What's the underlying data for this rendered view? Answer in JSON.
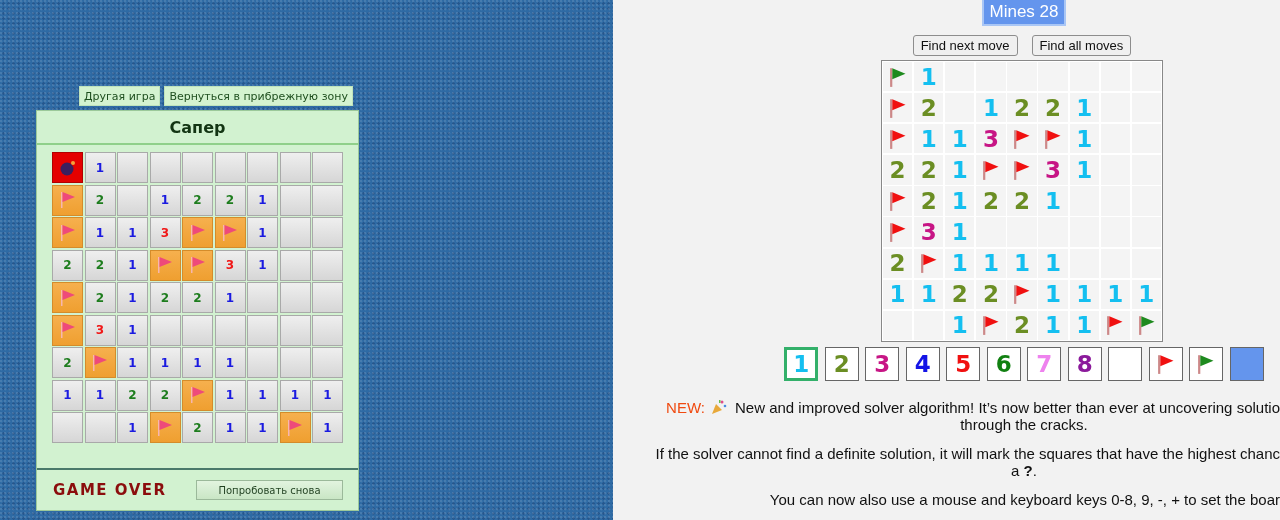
{
  "game": {
    "nav_buttons": [
      "Другая игра",
      "Вернуться в прибрежную зону"
    ],
    "title": "Сапер",
    "rows": [
      [
        {
          "kind": "mine"
        },
        {
          "kind": "number",
          "text": "1",
          "color": "#1a1ae0"
        },
        {
          "kind": "blank"
        },
        {
          "kind": "blank"
        },
        {
          "kind": "blank"
        },
        {
          "kind": "blank"
        },
        {
          "kind": "blank"
        },
        {
          "kind": "blank"
        },
        {
          "kind": "blank"
        }
      ],
      [
        {
          "kind": "flag"
        },
        {
          "kind": "number",
          "text": "2",
          "color": "#1e7d1e"
        },
        {
          "kind": "blank"
        },
        {
          "kind": "number",
          "text": "1",
          "color": "#1a1ae0"
        },
        {
          "kind": "number",
          "text": "2",
          "color": "#1e7d1e"
        },
        {
          "kind": "number",
          "text": "2",
          "color": "#1e7d1e"
        },
        {
          "kind": "number",
          "text": "1",
          "color": "#1a1ae0"
        },
        {
          "kind": "blank"
        },
        {
          "kind": "blank"
        }
      ],
      [
        {
          "kind": "flag"
        },
        {
          "kind": "number",
          "text": "1",
          "color": "#1a1ae0"
        },
        {
          "kind": "number",
          "text": "1",
          "color": "#1a1ae0"
        },
        {
          "kind": "number",
          "text": "3",
          "color": "#f01818"
        },
        {
          "kind": "flag"
        },
        {
          "kind": "flag"
        },
        {
          "kind": "number",
          "text": "1",
          "color": "#1a1ae0"
        },
        {
          "kind": "blank"
        },
        {
          "kind": "blank"
        }
      ],
      [
        {
          "kind": "number",
          "text": "2",
          "color": "#1e7d1e"
        },
        {
          "kind": "number",
          "text": "2",
          "color": "#1e7d1e"
        },
        {
          "kind": "number",
          "text": "1",
          "color": "#1a1ae0"
        },
        {
          "kind": "flag"
        },
        {
          "kind": "flag"
        },
        {
          "kind": "number",
          "text": "3",
          "color": "#f01818"
        },
        {
          "kind": "number",
          "text": "1",
          "color": "#1a1ae0"
        },
        {
          "kind": "blank"
        },
        {
          "kind": "blank"
        }
      ],
      [
        {
          "kind": "flag"
        },
        {
          "kind": "number",
          "text": "2",
          "color": "#1e7d1e"
        },
        {
          "kind": "number",
          "text": "1",
          "color": "#1a1ae0"
        },
        {
          "kind": "number",
          "text": "2",
          "color": "#1e7d1e"
        },
        {
          "kind": "number",
          "text": "2",
          "color": "#1e7d1e"
        },
        {
          "kind": "number",
          "text": "1",
          "color": "#1a1ae0"
        },
        {
          "kind": "blank"
        },
        {
          "kind": "blank"
        },
        {
          "kind": "blank"
        }
      ],
      [
        {
          "kind": "flag"
        },
        {
          "kind": "number",
          "text": "3",
          "color": "#f01818"
        },
        {
          "kind": "number",
          "text": "1",
          "color": "#1a1ae0"
        },
        {
          "kind": "blank"
        },
        {
          "kind": "blank"
        },
        {
          "kind": "blank"
        },
        {
          "kind": "blank"
        },
        {
          "kind": "blank"
        },
        {
          "kind": "blank"
        }
      ],
      [
        {
          "kind": "number",
          "text": "2",
          "color": "#1e7d1e"
        },
        {
          "kind": "flag"
        },
        {
          "kind": "number",
          "text": "1",
          "color": "#1a1ae0"
        },
        {
          "kind": "number",
          "text": "1",
          "color": "#1a1ae0"
        },
        {
          "kind": "number",
          "text": "1",
          "color": "#1a1ae0"
        },
        {
          "kind": "number",
          "text": "1",
          "color": "#1a1ae0"
        },
        {
          "kind": "blank"
        },
        {
          "kind": "blank"
        },
        {
          "kind": "blank"
        }
      ],
      [
        {
          "kind": "number",
          "text": "1",
          "color": "#1a1ae0"
        },
        {
          "kind": "number",
          "text": "1",
          "color": "#1a1ae0"
        },
        {
          "kind": "number",
          "text": "2",
          "color": "#1e7d1e"
        },
        {
          "kind": "number",
          "text": "2",
          "color": "#1e7d1e"
        },
        {
          "kind": "flag"
        },
        {
          "kind": "number",
          "text": "1",
          "color": "#1a1ae0"
        },
        {
          "kind": "number",
          "text": "1",
          "color": "#1a1ae0"
        },
        {
          "kind": "number",
          "text": "1",
          "color": "#1a1ae0"
        },
        {
          "kind": "number",
          "text": "1",
          "color": "#1a1ae0"
        }
      ],
      [
        {
          "kind": "blank"
        },
        {
          "kind": "blank"
        },
        {
          "kind": "number",
          "text": "1",
          "color": "#1a1ae0"
        },
        {
          "kind": "flag"
        },
        {
          "kind": "number",
          "text": "2",
          "color": "#1e7d1e"
        },
        {
          "kind": "number",
          "text": "1",
          "color": "#1a1ae0"
        },
        {
          "kind": "number",
          "text": "1",
          "color": "#1a1ae0"
        },
        {
          "kind": "flag"
        },
        {
          "kind": "number",
          "text": "1",
          "color": "#1a1ae0"
        }
      ]
    ],
    "status": "GAME OVER",
    "retry_button": "Попробовать снова"
  },
  "solver": {
    "mines_badge": "Mines 28",
    "buttons": [
      "Find next move",
      "Find all moves"
    ],
    "rows": [
      [
        {
          "kind": "flag",
          "color": "#1e8a1e"
        },
        {
          "kind": "number",
          "text": "1",
          "color": "#14bff0"
        },
        {
          "kind": "empty"
        },
        {
          "kind": "empty"
        },
        {
          "kind": "empty"
        },
        {
          "kind": "empty"
        },
        {
          "kind": "empty"
        },
        {
          "kind": "empty"
        },
        {
          "kind": "empty"
        }
      ],
      [
        {
          "kind": "flag",
          "color": "#f01010"
        },
        {
          "kind": "number",
          "text": "2",
          "color": "#6b8e23"
        },
        {
          "kind": "empty"
        },
        {
          "kind": "number",
          "text": "1",
          "color": "#14bff0"
        },
        {
          "kind": "number",
          "text": "2",
          "color": "#6b8e23"
        },
        {
          "kind": "number",
          "text": "2",
          "color": "#6b8e23"
        },
        {
          "kind": "number",
          "text": "1",
          "color": "#14bff0"
        },
        {
          "kind": "empty"
        },
        {
          "kind": "empty"
        }
      ],
      [
        {
          "kind": "flag",
          "color": "#f01010"
        },
        {
          "kind": "number",
          "text": "1",
          "color": "#14bff0"
        },
        {
          "kind": "number",
          "text": "1",
          "color": "#14bff0"
        },
        {
          "kind": "number",
          "text": "3",
          "color": "#c71585"
        },
        {
          "kind": "flag",
          "color": "#f01010"
        },
        {
          "kind": "flag",
          "color": "#f01010"
        },
        {
          "kind": "number",
          "text": "1",
          "color": "#14bff0"
        },
        {
          "kind": "empty"
        },
        {
          "kind": "empty"
        }
      ],
      [
        {
          "kind": "number",
          "text": "2",
          "color": "#6b8e23"
        },
        {
          "kind": "number",
          "text": "2",
          "color": "#6b8e23"
        },
        {
          "kind": "number",
          "text": "1",
          "color": "#14bff0"
        },
        {
          "kind": "flag",
          "color": "#f01010"
        },
        {
          "kind": "flag",
          "color": "#f01010"
        },
        {
          "kind": "number",
          "text": "3",
          "color": "#c71585"
        },
        {
          "kind": "number",
          "text": "1",
          "color": "#14bff0"
        },
        {
          "kind": "empty"
        },
        {
          "kind": "empty"
        }
      ],
      [
        {
          "kind": "flag",
          "color": "#f01010"
        },
        {
          "kind": "number",
          "text": "2",
          "color": "#6b8e23"
        },
        {
          "kind": "number",
          "text": "1",
          "color": "#14bff0"
        },
        {
          "kind": "number",
          "text": "2",
          "color": "#6b8e23"
        },
        {
          "kind": "number",
          "text": "2",
          "color": "#6b8e23"
        },
        {
          "kind": "number",
          "text": "1",
          "color": "#14bff0"
        },
        {
          "kind": "empty"
        },
        {
          "kind": "empty"
        },
        {
          "kind": "empty"
        }
      ],
      [
        {
          "kind": "flag",
          "color": "#f01010"
        },
        {
          "kind": "number",
          "text": "3",
          "color": "#c71585"
        },
        {
          "kind": "number",
          "text": "1",
          "color": "#14bff0"
        },
        {
          "kind": "empty"
        },
        {
          "kind": "empty"
        },
        {
          "kind": "empty"
        },
        {
          "kind": "empty"
        },
        {
          "kind": "empty"
        },
        {
          "kind": "empty"
        }
      ],
      [
        {
          "kind": "number",
          "text": "2",
          "color": "#6b8e23"
        },
        {
          "kind": "flag",
          "color": "#f01010"
        },
        {
          "kind": "number",
          "text": "1",
          "color": "#14bff0"
        },
        {
          "kind": "number",
          "text": "1",
          "color": "#14bff0"
        },
        {
          "kind": "number",
          "text": "1",
          "color": "#14bff0"
        },
        {
          "kind": "number",
          "text": "1",
          "color": "#14bff0"
        },
        {
          "kind": "empty"
        },
        {
          "kind": "empty"
        },
        {
          "kind": "empty"
        }
      ],
      [
        {
          "kind": "number",
          "text": "1",
          "color": "#14bff0"
        },
        {
          "kind": "number",
          "text": "1",
          "color": "#14bff0"
        },
        {
          "kind": "number",
          "text": "2",
          "color": "#6b8e23"
        },
        {
          "kind": "number",
          "text": "2",
          "color": "#6b8e23"
        },
        {
          "kind": "flag",
          "color": "#f01010"
        },
        {
          "kind": "number",
          "text": "1",
          "color": "#14bff0"
        },
        {
          "kind": "number",
          "text": "1",
          "color": "#14bff0"
        },
        {
          "kind": "number",
          "text": "1",
          "color": "#14bff0"
        },
        {
          "kind": "number",
          "text": "1",
          "color": "#14bff0"
        }
      ],
      [
        {
          "kind": "empty"
        },
        {
          "kind": "empty"
        },
        {
          "kind": "number",
          "text": "1",
          "color": "#14bff0"
        },
        {
          "kind": "flag",
          "color": "#f01010"
        },
        {
          "kind": "number",
          "text": "2",
          "color": "#6b8e23"
        },
        {
          "kind": "number",
          "text": "1",
          "color": "#14bff0"
        },
        {
          "kind": "number",
          "text": "1",
          "color": "#14bff0"
        },
        {
          "kind": "flag",
          "color": "#f01010"
        },
        {
          "kind": "flag",
          "color": "#1e8a1e"
        }
      ]
    ],
    "palette": [
      {
        "kind": "number",
        "text": "1",
        "color": "#14bff0",
        "selected": true
      },
      {
        "kind": "number",
        "text": "2",
        "color": "#6b8e23",
        "selected": false
      },
      {
        "kind": "number",
        "text": "3",
        "color": "#c71585",
        "selected": false
      },
      {
        "kind": "number",
        "text": "4",
        "color": "#1414e6",
        "selected": false
      },
      {
        "kind": "number",
        "text": "5",
        "color": "#f01010",
        "selected": false
      },
      {
        "kind": "number",
        "text": "6",
        "color": "#118011",
        "selected": false
      },
      {
        "kind": "number",
        "text": "7",
        "color": "#ee82ee",
        "selected": false
      },
      {
        "kind": "number",
        "text": "8",
        "color": "#8b1a9b",
        "selected": false
      },
      {
        "kind": "empty",
        "selected": false
      },
      {
        "kind": "flag",
        "color": "#f01010",
        "selected": false
      },
      {
        "kind": "flag",
        "color": "#1e8a1e",
        "selected": false
      },
      {
        "kind": "swatch",
        "color": "#6495ed",
        "selected": false
      }
    ],
    "new_label": "NEW:",
    "info_lines": [
      {
        "kind": "news",
        "text": "New and improved solver algorithm! It’s now better than ever at uncovering solutio"
      },
      {
        "kind": "center",
        "text": "through the cracks."
      },
      {
        "kind": "cut",
        "text": "If the solver cannot find a definite solution, it will mark the squares that have the highest chanc"
      },
      {
        "kind": "center",
        "text": "a **?**."
      },
      {
        "kind": "cut",
        "text": "You can now also use a mouse and keyboard keys 0-8, 9, -, + to set the boar"
      }
    ]
  }
}
